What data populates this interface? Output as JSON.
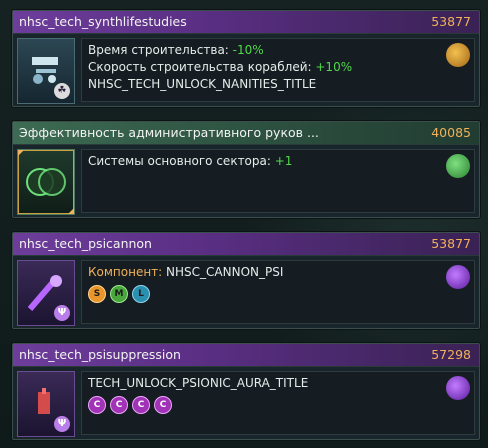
{
  "cards": [
    {
      "name": "nhsc_tech_synthlifestudies",
      "cost": "53877",
      "area": "engineering",
      "lines": [
        {
          "label": "Время строительства:",
          "value": "-10%"
        },
        {
          "label": "Скорость строительства кораблей:",
          "value": "+10%"
        },
        {
          "label": "NHSC_TECH_UNLOCK_NANITIES_TITLE",
          "value": ""
        }
      ],
      "badge": "☘"
    },
    {
      "name": "Эффективность административного руков ...",
      "cost": "40085",
      "area": "society",
      "lines": [
        {
          "label": "Системы основного сектора:",
          "value": "+1"
        }
      ]
    },
    {
      "name": "nhsc_tech_psicannon",
      "cost": "53877",
      "area": "physics",
      "component_label": "Компонент:",
      "component_value": "NHSC_CANNON_PSI",
      "slots": [
        "S",
        "M",
        "L"
      ],
      "badge": "Ψ"
    },
    {
      "name": "nhsc_tech_psisuppression",
      "cost": "57298",
      "area": "physics",
      "lines": [
        {
          "label": "TECH_UNLOCK_PSIONIC_AURA_TITLE",
          "value": ""
        }
      ],
      "slots": [
        "C",
        "C",
        "C",
        "C"
      ],
      "badge": "Ψ"
    }
  ],
  "colors": {
    "physics": "#6d3d9b",
    "society": "#3d6b53",
    "cost": "#f0b15a",
    "positive": "#4fd84a"
  }
}
